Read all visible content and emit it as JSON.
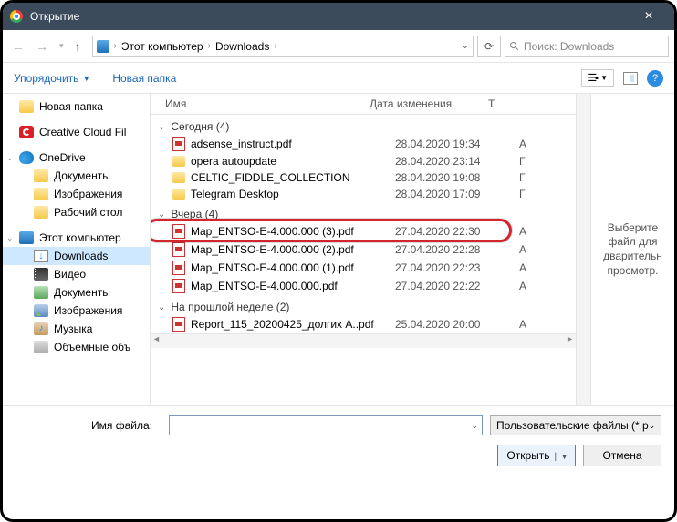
{
  "window": {
    "title": "Открытие"
  },
  "breadcrumb": {
    "root": "Этот компьютер",
    "folder": "Downloads"
  },
  "search": {
    "placeholder": "Поиск: Downloads"
  },
  "toolbar": {
    "organize": "Упорядочить",
    "newfolder": "Новая папка"
  },
  "tree": {
    "items": [
      {
        "label": "Новая папка",
        "icon": "folder"
      },
      {
        "label": "Creative Cloud Fil",
        "icon": "cc"
      },
      {
        "label": "OneDrive",
        "icon": "onedrive",
        "exp": true
      },
      {
        "label": "Документы",
        "icon": "folder",
        "indent": true
      },
      {
        "label": "Изображения",
        "icon": "folder",
        "indent": true
      },
      {
        "label": "Рабочий стол",
        "icon": "folder",
        "indent": true
      },
      {
        "label": "Этот компьютер",
        "icon": "pc",
        "exp": true
      },
      {
        "label": "Downloads",
        "icon": "dl",
        "indent": true,
        "sel": true
      },
      {
        "label": "Видео",
        "icon": "video",
        "indent": true
      },
      {
        "label": "Документы",
        "icon": "docs",
        "indent": true
      },
      {
        "label": "Изображения",
        "icon": "img",
        "indent": true
      },
      {
        "label": "Музыка",
        "icon": "music",
        "indent": true
      },
      {
        "label": "Объемные объ",
        "icon": "disk",
        "indent": true
      }
    ]
  },
  "columns": {
    "name": "Имя",
    "date": "Дата изменения",
    "type": "Т"
  },
  "groups": [
    {
      "title": "Сегодня (4)",
      "rows": [
        {
          "icon": "pdf",
          "name": "adsense_instruct.pdf",
          "date": "28.04.2020 19:34",
          "t": "A"
        },
        {
          "icon": "fold",
          "name": "opera autoupdate",
          "date": "28.04.2020 23:14",
          "t": "Г"
        },
        {
          "icon": "fold",
          "name": "CELTIC_FIDDLE_COLLECTION",
          "date": "28.04.2020 19:08",
          "t": "Г"
        },
        {
          "icon": "fold",
          "name": "Telegram Desktop",
          "date": "28.04.2020 17:09",
          "t": "Г"
        }
      ]
    },
    {
      "title": "Вчера (4)",
      "rows": [
        {
          "icon": "pdf",
          "name": "Map_ENTSO-E-4.000.000 (3).pdf",
          "date": "27.04.2020 22:30",
          "t": "A",
          "hl": true
        },
        {
          "icon": "pdf",
          "name": "Map_ENTSO-E-4.000.000 (2).pdf",
          "date": "27.04.2020 22:28",
          "t": "A"
        },
        {
          "icon": "pdf",
          "name": "Map_ENTSO-E-4.000.000 (1).pdf",
          "date": "27.04.2020 22:23",
          "t": "A"
        },
        {
          "icon": "pdf",
          "name": "Map_ENTSO-E-4.000.000.pdf",
          "date": "27.04.2020 22:22",
          "t": "A"
        }
      ]
    },
    {
      "title": "На прошлой неделе (2)",
      "rows": [
        {
          "icon": "pdf",
          "name": "Report_115_20200425_долгих А..pdf",
          "date": "25.04.2020 20:00",
          "t": "A"
        }
      ]
    }
  ],
  "preview": {
    "text": "Выберите файл для дварительн просмотр."
  },
  "footer": {
    "filename_label": "Имя файла:",
    "filename_value": "",
    "filter": "Пользовательские файлы (*.p",
    "open": "Открыть",
    "cancel": "Отмена"
  }
}
